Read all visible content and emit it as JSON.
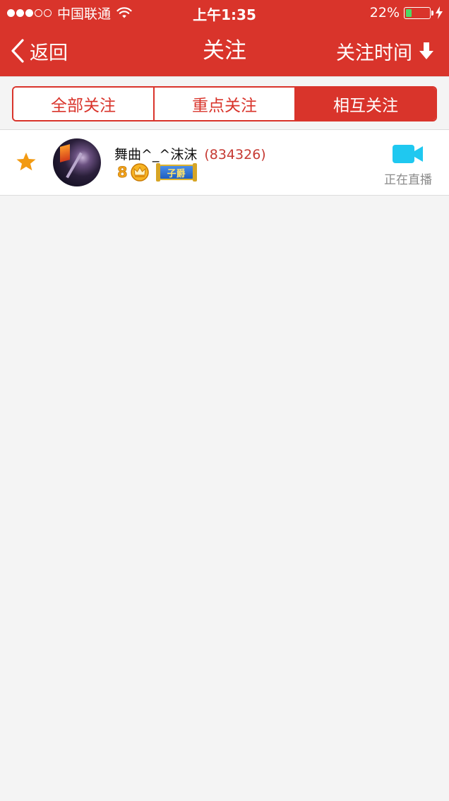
{
  "status_bar": {
    "carrier": "中国联通",
    "time": "上午1:35",
    "battery": "22%",
    "battery_level": 0.22,
    "signal_bars": 3
  },
  "nav": {
    "back_label": "返回",
    "title": "关注",
    "sort_label": "关注时间"
  },
  "tabs": [
    {
      "label": "全部关注",
      "active": false
    },
    {
      "label": "重点关注",
      "active": false
    },
    {
      "label": "相互关注",
      "active": true
    }
  ],
  "follows": [
    {
      "name": "舞曲^_^沫沫",
      "id": "(834326)",
      "level": "8",
      "rank": "子爵",
      "status": "正在直播",
      "starred": true
    }
  ],
  "colors": {
    "brand": "#d9342b",
    "star": "#f29a12",
    "live_icon": "#1fc8f0",
    "battery_fill": "#4cd964"
  },
  "icons": [
    "back-chevron-icon",
    "sort-down-arrow-icon",
    "star-icon",
    "crown-icon",
    "video-camera-icon",
    "wifi-icon",
    "charging-bolt-icon"
  ]
}
